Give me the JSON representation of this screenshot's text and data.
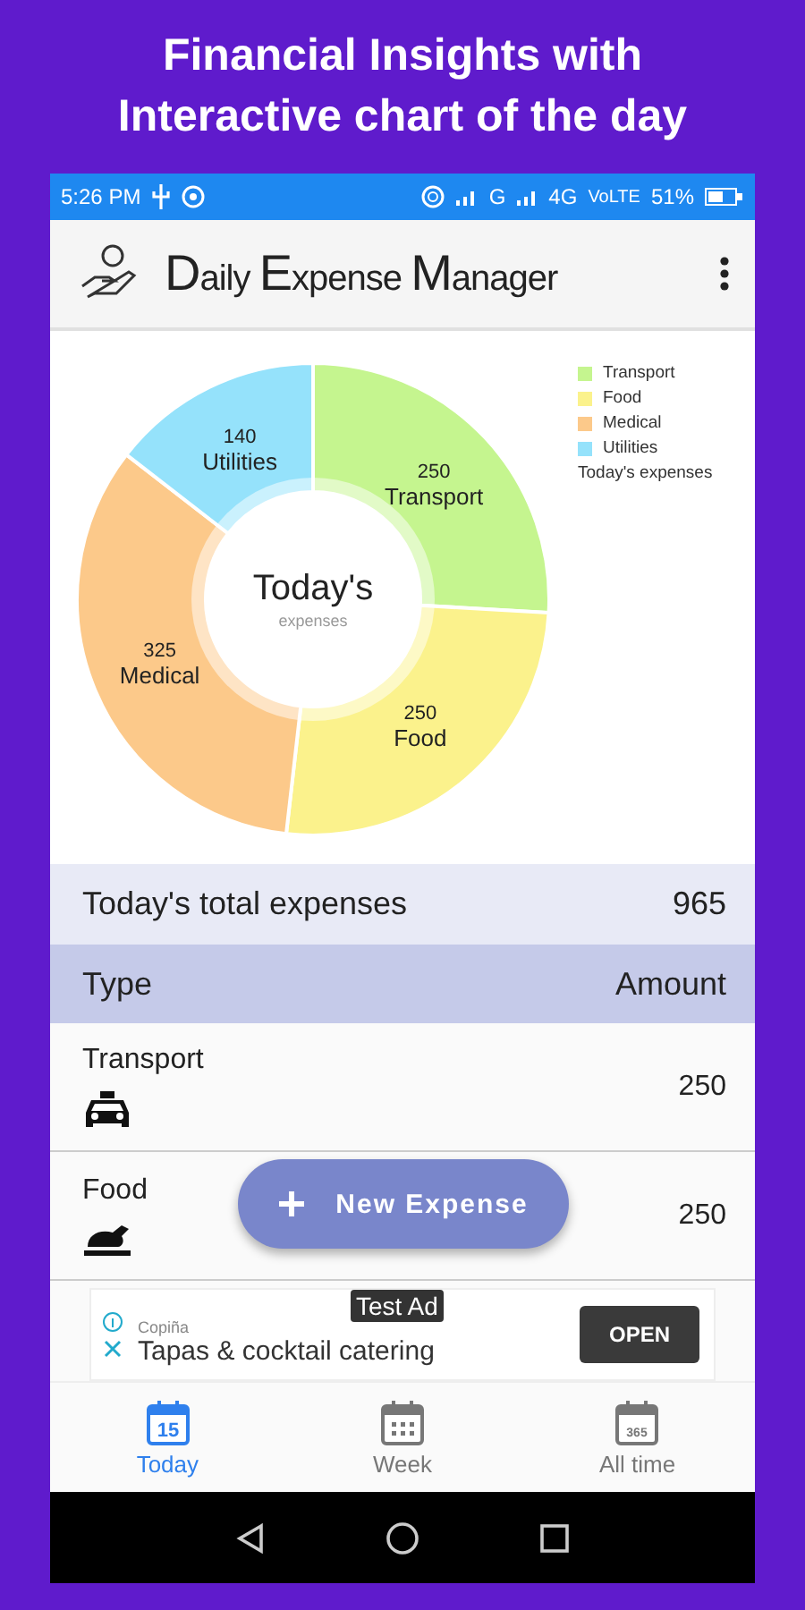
{
  "headline": [
    "Financial Insights with",
    "Interactive chart of the day"
  ],
  "status_bar": {
    "time": "5:26 PM",
    "network": "G",
    "network_2": "4G",
    "volte": "VoLTE",
    "battery": "51%"
  },
  "app_bar": {
    "title": "Daily Expense Manager"
  },
  "chart": {
    "center_title": "Today's",
    "center_subtitle": "expenses",
    "chart_data": {
      "type": "donut",
      "categories": [
        "Transport",
        "Food",
        "Medical",
        "Utilities"
      ],
      "series": [
        {
          "name": "Today's expenses",
          "values": [
            250,
            250,
            325,
            140
          ]
        }
      ],
      "colors": [
        "#c5f58f",
        "#fbf28c",
        "#fcc98a",
        "#95e2fb"
      ],
      "data_labels": true
    }
  },
  "total": {
    "label": "Today's total expenses",
    "value": "965"
  },
  "table": {
    "columns": [
      "Type",
      "Amount"
    ],
    "rows": [
      {
        "name": "Transport",
        "amount": "250",
        "kind": "car"
      },
      {
        "name": "Food",
        "amount": "250",
        "kind": "food"
      }
    ]
  },
  "fab": {
    "label": "New Expense"
  },
  "ad": {
    "badge": "Test Ad",
    "advertiser": "Copiña",
    "headline": "Tapas & cocktail catering",
    "button": "OPEN"
  },
  "tabs": [
    {
      "label": "Today",
      "selected": true,
      "icon_text": "15"
    },
    {
      "label": "Week",
      "selected": false
    },
    {
      "label": "All time",
      "selected": false,
      "icon_text": "365"
    }
  ]
}
